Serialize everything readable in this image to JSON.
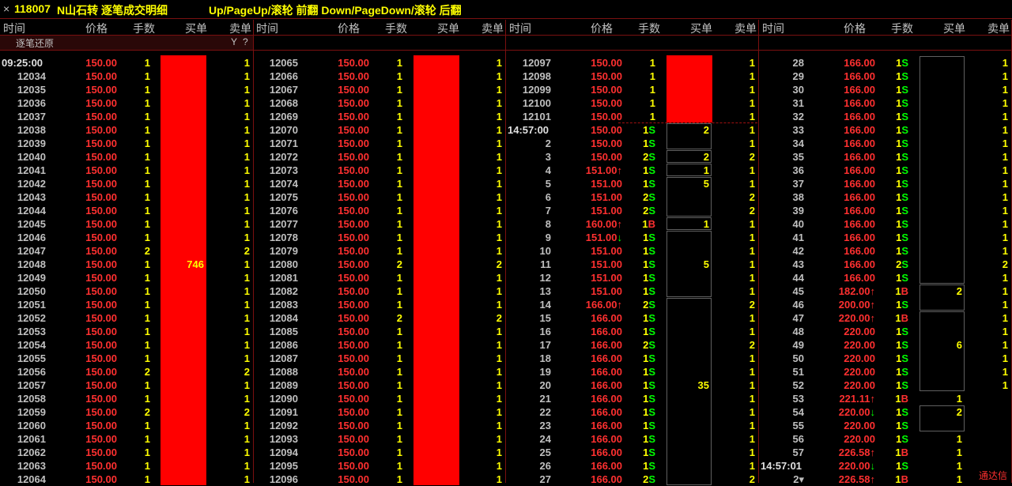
{
  "title": {
    "close": "×",
    "code": "118007",
    "name": "N山石转 逐笔成交明细",
    "hint": "Up/PageUp/滚轮 前翻 Down/PageDown/滚轮 后翻"
  },
  "headers": [
    "时间",
    "价格",
    "手数",
    "买单",
    "卖单"
  ],
  "sub": {
    "label": "逐笔还原",
    "filter_icon": "Y",
    "help": "?"
  },
  "brand": "通达信",
  "colors": {
    "red": "#ff0000",
    "price": "#ff3030",
    "green": "#00ff00",
    "yellow": "#ffff00",
    "border": "#7a1010"
  },
  "panels": [
    {
      "rows": [
        [
          "09:25:00",
          "150.00",
          "1",
          "",
          "1"
        ],
        [
          "12034",
          "150.00",
          "1",
          "",
          "1"
        ],
        [
          "12035",
          "150.00",
          "1",
          "",
          "1"
        ],
        [
          "12036",
          "150.00",
          "1",
          "",
          "1"
        ],
        [
          "12037",
          "150.00",
          "1",
          "",
          "1"
        ],
        [
          "12038",
          "150.00",
          "1",
          "",
          "1"
        ],
        [
          "12039",
          "150.00",
          "1",
          "",
          "1"
        ],
        [
          "12040",
          "150.00",
          "1",
          "",
          "1"
        ],
        [
          "12041",
          "150.00",
          "1",
          "",
          "1"
        ],
        [
          "12042",
          "150.00",
          "1",
          "",
          "1"
        ],
        [
          "12043",
          "150.00",
          "1",
          "",
          "1"
        ],
        [
          "12044",
          "150.00",
          "1",
          "",
          "1"
        ],
        [
          "12045",
          "150.00",
          "1",
          "",
          "1"
        ],
        [
          "12046",
          "150.00",
          "1",
          "",
          "1"
        ],
        [
          "12047",
          "150.00",
          "2",
          "",
          "2"
        ],
        [
          "12048",
          "150.00",
          "1",
          "",
          "1"
        ],
        [
          "12049",
          "150.00",
          "1",
          "",
          "1"
        ],
        [
          "12050",
          "150.00",
          "1",
          "",
          "1"
        ],
        [
          "12051",
          "150.00",
          "1",
          "",
          "1"
        ],
        [
          "12052",
          "150.00",
          "1",
          "",
          "1"
        ],
        [
          "12053",
          "150.00",
          "1",
          "",
          "1"
        ],
        [
          "12054",
          "150.00",
          "1",
          "",
          "1"
        ],
        [
          "12055",
          "150.00",
          "1",
          "",
          "1"
        ],
        [
          "12056",
          "150.00",
          "2",
          "",
          "2"
        ],
        [
          "12057",
          "150.00",
          "1",
          "",
          "1"
        ],
        [
          "12058",
          "150.00",
          "1",
          "",
          "1"
        ],
        [
          "12059",
          "150.00",
          "2",
          "",
          "2"
        ],
        [
          "12060",
          "150.00",
          "1",
          "",
          "1"
        ],
        [
          "12061",
          "150.00",
          "1",
          "",
          "1"
        ],
        [
          "12062",
          "150.00",
          "1",
          "",
          "1"
        ],
        [
          "12063",
          "150.00",
          "1",
          "",
          "1"
        ],
        [
          "12064",
          "150.00",
          "1",
          "",
          "1"
        ]
      ],
      "buy_blocks": [
        {
          "start": 0,
          "end": 31,
          "value": "746",
          "label_row": 15,
          "fill": true
        }
      ]
    },
    {
      "rows": [
        [
          "12065",
          "150.00",
          "1",
          "",
          "1"
        ],
        [
          "12066",
          "150.00",
          "1",
          "",
          "1"
        ],
        [
          "12067",
          "150.00",
          "1",
          "",
          "1"
        ],
        [
          "12068",
          "150.00",
          "1",
          "",
          "1"
        ],
        [
          "12069",
          "150.00",
          "1",
          "",
          "1"
        ],
        [
          "12070",
          "150.00",
          "1",
          "",
          "1"
        ],
        [
          "12071",
          "150.00",
          "1",
          "",
          "1"
        ],
        [
          "12072",
          "150.00",
          "1",
          "",
          "1"
        ],
        [
          "12073",
          "150.00",
          "1",
          "",
          "1"
        ],
        [
          "12074",
          "150.00",
          "1",
          "",
          "1"
        ],
        [
          "12075",
          "150.00",
          "1",
          "",
          "1"
        ],
        [
          "12076",
          "150.00",
          "1",
          "",
          "1"
        ],
        [
          "12077",
          "150.00",
          "1",
          "",
          "1"
        ],
        [
          "12078",
          "150.00",
          "1",
          "",
          "1"
        ],
        [
          "12079",
          "150.00",
          "1",
          "",
          "1"
        ],
        [
          "12080",
          "150.00",
          "2",
          "",
          "2"
        ],
        [
          "12081",
          "150.00",
          "1",
          "",
          "1"
        ],
        [
          "12082",
          "150.00",
          "1",
          "",
          "1"
        ],
        [
          "12083",
          "150.00",
          "1",
          "",
          "1"
        ],
        [
          "12084",
          "150.00",
          "2",
          "",
          "2"
        ],
        [
          "12085",
          "150.00",
          "1",
          "",
          "1"
        ],
        [
          "12086",
          "150.00",
          "1",
          "",
          "1"
        ],
        [
          "12087",
          "150.00",
          "1",
          "",
          "1"
        ],
        [
          "12088",
          "150.00",
          "1",
          "",
          "1"
        ],
        [
          "12089",
          "150.00",
          "1",
          "",
          "1"
        ],
        [
          "12090",
          "150.00",
          "1",
          "",
          "1"
        ],
        [
          "12091",
          "150.00",
          "1",
          "",
          "1"
        ],
        [
          "12092",
          "150.00",
          "1",
          "",
          "1"
        ],
        [
          "12093",
          "150.00",
          "1",
          "",
          "1"
        ],
        [
          "12094",
          "150.00",
          "1",
          "",
          "1"
        ],
        [
          "12095",
          "150.00",
          "1",
          "",
          "1"
        ],
        [
          "12096",
          "150.00",
          "1",
          "",
          "1"
        ]
      ],
      "buy_blocks": [
        {
          "start": 0,
          "end": 31,
          "value": "",
          "label_row": 0,
          "fill": true
        }
      ]
    },
    {
      "rows": [
        [
          "12097",
          "150.00",
          "1",
          "",
          "1"
        ],
        [
          "12098",
          "150.00",
          "1",
          "",
          "1"
        ],
        [
          "12099",
          "150.00",
          "1",
          "",
          "1"
        ],
        [
          "12100",
          "150.00",
          "1",
          "",
          "1"
        ],
        [
          "12101",
          "150.00",
          "1",
          "",
          "1"
        ],
        [
          "14:57:00",
          "150.00",
          "1S",
          "",
          "1"
        ],
        [
          "2",
          "150.00",
          "1S",
          "",
          "1"
        ],
        [
          "3",
          "150.00",
          "2S",
          "",
          "2"
        ],
        [
          "4",
          "151.00↑",
          "1S",
          "",
          "1"
        ],
        [
          "5",
          "151.00",
          "1S",
          "",
          "1"
        ],
        [
          "6",
          "151.00",
          "2S",
          "",
          "2"
        ],
        [
          "7",
          "151.00",
          "2S",
          "",
          "2"
        ],
        [
          "8",
          "160.00↑",
          "1B",
          "",
          "1"
        ],
        [
          "9",
          "151.00↓",
          "1S",
          "",
          "1"
        ],
        [
          "10",
          "151.00",
          "1S",
          "",
          "1"
        ],
        [
          "11",
          "151.00",
          "1S",
          "",
          "1"
        ],
        [
          "12",
          "151.00",
          "1S",
          "",
          "1"
        ],
        [
          "13",
          "151.00",
          "1S",
          "",
          "1"
        ],
        [
          "14",
          "166.00↑",
          "2S",
          "",
          "2"
        ],
        [
          "15",
          "166.00",
          "1S",
          "",
          "1"
        ],
        [
          "16",
          "166.00",
          "1S",
          "",
          "1"
        ],
        [
          "17",
          "166.00",
          "2S",
          "",
          "2"
        ],
        [
          "18",
          "166.00",
          "1S",
          "",
          "1"
        ],
        [
          "19",
          "166.00",
          "1S",
          "",
          "1"
        ],
        [
          "20",
          "166.00",
          "1S",
          "",
          "1"
        ],
        [
          "21",
          "166.00",
          "1S",
          "",
          "1"
        ],
        [
          "22",
          "166.00",
          "1S",
          "",
          "1"
        ],
        [
          "23",
          "166.00",
          "1S",
          "",
          "1"
        ],
        [
          "24",
          "166.00",
          "1S",
          "",
          "1"
        ],
        [
          "25",
          "166.00",
          "1S",
          "",
          "1"
        ],
        [
          "26",
          "166.00",
          "1S",
          "",
          "1"
        ],
        [
          "27",
          "166.00",
          "2S",
          "",
          "2"
        ]
      ],
      "buy_blocks": [
        {
          "start": 0,
          "end": 4,
          "value": "",
          "label_row": 0,
          "fill": true
        },
        {
          "start": 5,
          "end": 6,
          "value": "2",
          "label_row": 5,
          "fill": false
        },
        {
          "start": 7,
          "end": 7,
          "value": "2",
          "label_row": 7,
          "fill": false
        },
        {
          "start": 8,
          "end": 8,
          "value": "1",
          "label_row": 8,
          "fill": false
        },
        {
          "start": 9,
          "end": 11,
          "value": "5",
          "label_row": 9,
          "fill": false
        },
        {
          "start": 12,
          "end": 12,
          "value": "1",
          "label_row": 12,
          "fill": false
        },
        {
          "start": 13,
          "end": 17,
          "value": "5",
          "label_row": 15,
          "fill": false
        },
        {
          "start": 18,
          "end": 31,
          "value": "35",
          "label_row": 24,
          "fill": false
        }
      ],
      "dash_after": 4
    },
    {
      "rows": [
        [
          "28",
          "166.00",
          "1S",
          "",
          "1"
        ],
        [
          "29",
          "166.00",
          "1S",
          "",
          "1"
        ],
        [
          "30",
          "166.00",
          "1S",
          "",
          "1"
        ],
        [
          "31",
          "166.00",
          "1S",
          "",
          "1"
        ],
        [
          "32",
          "166.00",
          "1S",
          "",
          "1"
        ],
        [
          "33",
          "166.00",
          "1S",
          "",
          "1"
        ],
        [
          "34",
          "166.00",
          "1S",
          "",
          "1"
        ],
        [
          "35",
          "166.00",
          "1S",
          "",
          "1"
        ],
        [
          "36",
          "166.00",
          "1S",
          "",
          "1"
        ],
        [
          "37",
          "166.00",
          "1S",
          "",
          "1"
        ],
        [
          "38",
          "166.00",
          "1S",
          "",
          "1"
        ],
        [
          "39",
          "166.00",
          "1S",
          "",
          "1"
        ],
        [
          "40",
          "166.00",
          "1S",
          "",
          "1"
        ],
        [
          "41",
          "166.00",
          "1S",
          "",
          "1"
        ],
        [
          "42",
          "166.00",
          "1S",
          "",
          "1"
        ],
        [
          "43",
          "166.00",
          "2S",
          "",
          "2"
        ],
        [
          "44",
          "166.00",
          "1S",
          "",
          "1"
        ],
        [
          "45",
          "182.00↑",
          "1B",
          "",
          "1"
        ],
        [
          "46",
          "200.00↑",
          "1S",
          "",
          "1"
        ],
        [
          "47",
          "220.00↑",
          "1B",
          "",
          "1"
        ],
        [
          "48",
          "220.00",
          "1S",
          "",
          "1"
        ],
        [
          "49",
          "220.00",
          "1S",
          "",
          "1"
        ],
        [
          "50",
          "220.00",
          "1S",
          "",
          "1"
        ],
        [
          "51",
          "220.00",
          "1S",
          "",
          "1"
        ],
        [
          "52",
          "220.00",
          "1S",
          "",
          "1"
        ],
        [
          "53",
          "221.11↑",
          "1B",
          "1",
          ""
        ],
        [
          "54",
          "220.00↓",
          "1S",
          "",
          ""
        ],
        [
          "55",
          "220.00",
          "1S",
          "",
          ""
        ],
        [
          "56",
          "220.00",
          "1S",
          "1",
          ""
        ],
        [
          "57",
          "226.58↑",
          "1B",
          "1",
          ""
        ],
        [
          "14:57:01",
          "220.00↓",
          "1S",
          "1",
          ""
        ],
        [
          "2▾",
          "226.58↑",
          "1B",
          "1",
          ""
        ]
      ],
      "buy_blocks": [
        {
          "start": 0,
          "end": 16,
          "value": "",
          "label_row": 0,
          "fill": false
        },
        {
          "start": 17,
          "end": 18,
          "value": "2",
          "label_row": 17,
          "fill": false
        },
        {
          "start": 19,
          "end": 24,
          "value": "6",
          "label_row": 21,
          "fill": false
        },
        {
          "start": 26,
          "end": 27,
          "value": "2",
          "label_row": 26,
          "fill": false
        }
      ]
    }
  ]
}
